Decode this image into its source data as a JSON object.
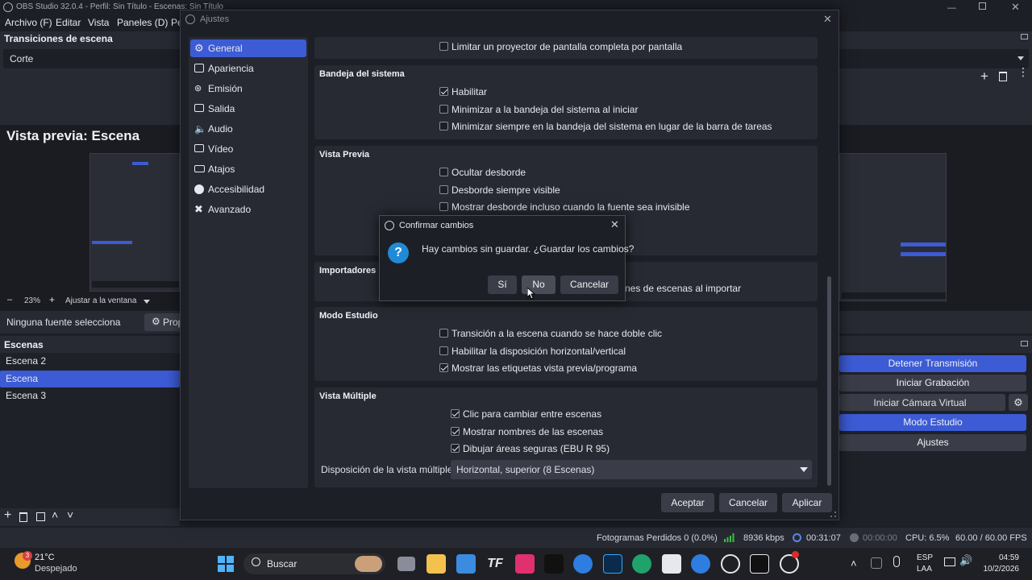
{
  "obs": {
    "title": "OBS Studio 32.0.4 - Perfil: Sin Título - Escenas: Sin Título",
    "menu": [
      "Archivo (F)",
      "Editar",
      "Vista",
      "Paneles (D)",
      "Pe"
    ],
    "transitions_title": "Transiciones de escena",
    "transition_value": "Corte",
    "preview_title": "Vista previa: Escena",
    "zoom": "23%",
    "zoom_fit": "Ajustar a la ventana",
    "no_source": "Ninguna fuente selecciona",
    "properties_button": "Prop",
    "scenes_title": "Escenas",
    "scenes": [
      "Escena 2",
      "Escena",
      "Escena 3"
    ],
    "controls": {
      "stop_stream": "Detener Transmisión",
      "start_record": "Iniciar Grabación",
      "virtual_cam": "Iniciar Cámara Virtual",
      "studio_mode": "Modo Estudio",
      "settings": "Ajustes"
    },
    "status": {
      "dropped": "Fotogramas Perdidos 0 (0.0%)",
      "bitrate": "8936 kbps",
      "stream_time": "00:31:07",
      "record_time": "00:00:00",
      "cpu": "CPU: 6.5%",
      "fps": "60.00 / 60.00 FPS"
    }
  },
  "settings": {
    "title": "Ajustes",
    "sidebar": [
      "General",
      "Apariencia",
      "Emisión",
      "Salida",
      "Audio",
      "Vídeo",
      "Atajos",
      "Accesibilidad",
      "Avanzado"
    ],
    "top_checkbox": "Limitar un proyector de pantalla completa por pantalla",
    "tray": {
      "title": "Bandeja del sistema",
      "items": [
        "Habilitar",
        "Minimizar a la bandeja del sistema al iniciar",
        "Minimizar siempre en la bandeja del sistema en lugar de la barra de tareas"
      ]
    },
    "preview": {
      "title": "Vista Previa",
      "items": [
        "Ocultar desborde",
        "Desborde siempre visible",
        "Mostrar desborde incluso cuando la fuente sea invisible"
      ]
    },
    "importers": {
      "title": "Importadores",
      "item_tail": "nes de escenas al importar"
    },
    "studio": {
      "title": "Modo Estudio",
      "items": [
        "Transición a la escena cuando se hace doble clic",
        "Habilitar la disposición horizontal/vertical",
        "Mostrar las etiquetas vista previa/programa"
      ]
    },
    "multiview": {
      "title": "Vista Múltiple",
      "items": [
        "Clic para cambiar entre escenas",
        "Mostrar nombres de las escenas",
        "Dibujar áreas seguras (EBU R 95)"
      ],
      "layout_label": "Disposición de la vista múltiple",
      "layout_value": "Horizontal, superior (8 Escenas)"
    },
    "buttons": {
      "accept": "Aceptar",
      "cancel": "Cancelar",
      "apply": "Aplicar"
    }
  },
  "confirm": {
    "title": "Confirmar cambios",
    "message": "Hay cambios sin guardar. ¿Guardar los cambios?",
    "yes": "Sí",
    "no": "No",
    "cancel": "Cancelar"
  },
  "taskbar": {
    "weather_temp": "21°C",
    "weather_desc": "Despejado",
    "weather_badge": "3",
    "search": "Buscar",
    "lang1": "ESP",
    "lang2": "LAA",
    "time": "04:59",
    "date": "10/2/2026"
  },
  "colors": {
    "accent": "#3c5bd4",
    "bg": "#1d1f26",
    "panel": "#272a33"
  }
}
